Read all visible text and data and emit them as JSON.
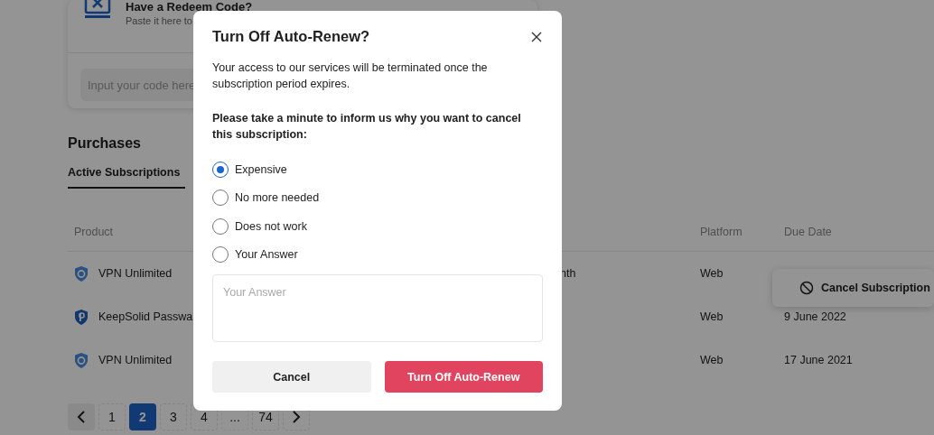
{
  "redeem_card": {
    "title": "Have a Redeem Code?",
    "subtitle": "Paste it here to",
    "input_placeholder": "Input your code here"
  },
  "purchases": {
    "heading": "Purchases",
    "tabs": [
      {
        "label": "Active Subscriptions",
        "selected": true
      }
    ],
    "table": {
      "columns": [
        "Product",
        "",
        "Platform",
        "Due Date"
      ],
      "rows": [
        {
          "kind": "vpn",
          "product": "VPN Unlimited",
          "column_2": "nth",
          "platform": "Web"
        },
        {
          "kind": "password",
          "product": "KeepSolid Passwa",
          "platform": "Web",
          "due_date": "9 June 2022"
        },
        {
          "kind": "vpn",
          "product": "VPN Unlimited",
          "platform": "Web",
          "due_date": "17 June 2021"
        }
      ]
    },
    "pagination": {
      "pages": [
        {
          "label": "1",
          "selected": false
        },
        {
          "label": "2",
          "selected": true
        },
        {
          "label": "3",
          "selected": false
        },
        {
          "label": "4",
          "selected": false
        },
        {
          "label": "...",
          "kind": "gap"
        },
        {
          "label": "74",
          "selected": false
        }
      ]
    }
  },
  "row_menu": {
    "items": [
      {
        "label": "Cancel Subscription"
      }
    ]
  },
  "dialog": {
    "title": "Turn Off Auto-Renew?",
    "message": "Your access to our services will be terminated once the subscription period expires.",
    "question": "Please take a minute to inform us why you want to cancel this subscription:",
    "options": [
      {
        "label": "Expensive",
        "selected": true
      },
      {
        "label": "No more needed",
        "selected": false
      },
      {
        "label": "Does not work",
        "selected": false
      },
      {
        "label": "Your Answer",
        "selected": false
      }
    ],
    "answer_placeholder": "Your Answer",
    "buttons": [
      {
        "label": "Cancel",
        "kind": "secondary"
      },
      {
        "label": "Turn Off Auto-Renew",
        "kind": "primary"
      }
    ]
  }
}
